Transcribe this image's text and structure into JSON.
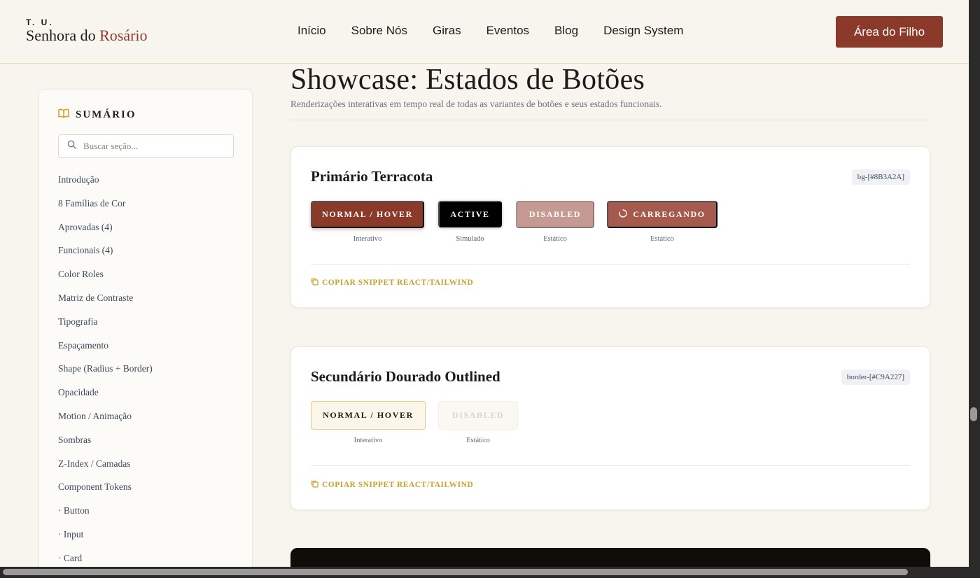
{
  "header": {
    "logo_small": "T. U.",
    "logo_main": "Senhora do ",
    "logo_accent": "Rosário",
    "nav": [
      "Início",
      "Sobre Nós",
      "Giras",
      "Eventos",
      "Blog",
      "Design System"
    ],
    "cta_label": "Área do Filho"
  },
  "sidebar": {
    "title": "SUMÁRIO",
    "search_placeholder": "Buscar seção...",
    "items": [
      "Introdução",
      "8 Famílias de Cor",
      "Aprovadas (4)",
      "Funcionais (4)",
      "Color Roles",
      "Matriz de Contraste",
      "Tipografia",
      "Espaçamento",
      "Shape (Radius + Border)",
      "Opacidade",
      "Motion / Animação",
      "Sombras",
      "Z-Index / Camadas",
      "Component Tokens",
      "· Button",
      "· Input",
      "· Card"
    ]
  },
  "main": {
    "title": "Showcase: Estados de Botões",
    "subtitle": "Renderizações interativas em tempo real de todas as variantes de botões e seus estados funcionais.",
    "cards": [
      {
        "title": "Primário Terracota",
        "token": "bg-[#8B3A2A]",
        "buttons": [
          {
            "label": "NORMAL / HOVER",
            "caption": "Interativo"
          },
          {
            "label": "ACTIVE",
            "caption": "Simulado"
          },
          {
            "label": "DISABLED",
            "caption": "Estático"
          },
          {
            "label": "CARREGANDO",
            "caption": "Estático"
          }
        ],
        "snippet": "COPIAR SNIPPET REACT/TAILWIND"
      },
      {
        "title": "Secundário Dourado Outlined",
        "token": "border-[#C9A227]",
        "buttons": [
          {
            "label": "NORMAL / HOVER",
            "caption": "Interativo"
          },
          {
            "label": "DISABLED",
            "caption": "Estático"
          }
        ],
        "snippet": "COPIAR SNIPPET REACT/TAILWIND"
      }
    ]
  },
  "colors": {
    "primary": "#8B3A2A",
    "gold": "#C9A227",
    "background": "#F8F4EE"
  }
}
